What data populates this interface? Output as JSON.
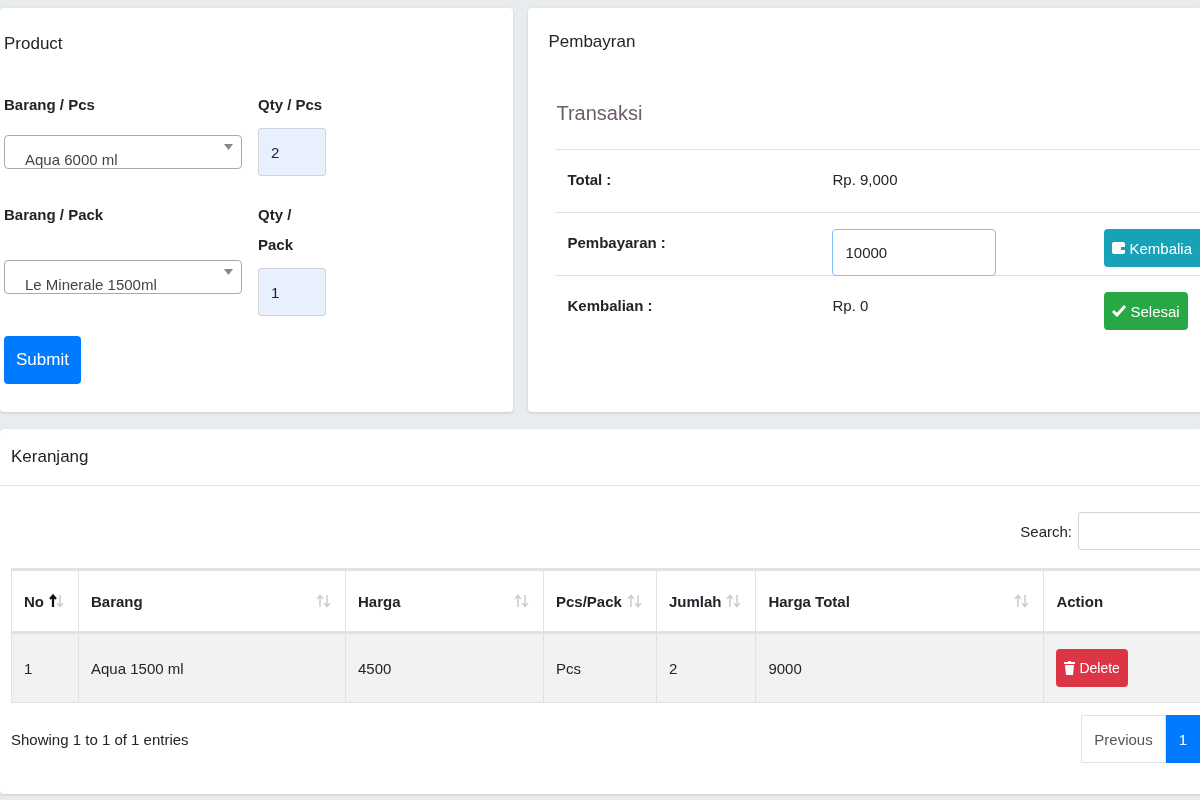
{
  "product": {
    "title": "Product",
    "rows": [
      {
        "item_label": "Barang / Pcs",
        "item_value": "Aqua 6000 ml",
        "qty_label": "Qty / Pcs",
        "qty_value": "2"
      },
      {
        "item_label": "Barang / Pack",
        "item_value": "Le Minerale 1500ml",
        "qty_label": "Qty / Pack",
        "qty_value": "1"
      }
    ],
    "submit": "Submit"
  },
  "payment": {
    "title": "Pembayran",
    "subtitle": "Transaksi",
    "rows": [
      {
        "kind": "text",
        "label": "Total :",
        "value": "Rp. 9,000"
      },
      {
        "kind": "input",
        "label": "Pembayaran :",
        "value": "10000",
        "action": {
          "kind": "info",
          "label": "Kembalia"
        }
      },
      {
        "kind": "text",
        "label": "Kembalian :",
        "value": "Rp. 0",
        "action": {
          "kind": "success",
          "label": "Selesai"
        }
      }
    ]
  },
  "cart": {
    "title": "Keranjang",
    "search_label": "Search:",
    "columns": [
      {
        "label": "No",
        "sortable": true,
        "sorted": true
      },
      {
        "label": "Barang",
        "sortable": true,
        "sorted": false
      },
      {
        "label": "Harga",
        "sortable": true,
        "sorted": false
      },
      {
        "label": "Pcs/Pack",
        "sortable": true,
        "sorted": false
      },
      {
        "label": "Jumlah",
        "sortable": true,
        "sorted": false
      },
      {
        "label": "Harga Total",
        "sortable": true,
        "sorted": false
      },
      {
        "label": "Action",
        "sortable": false
      }
    ],
    "rows": [
      {
        "cells": [
          "1",
          "Aqua 1500 ml",
          "4500",
          "Pcs",
          "2",
          "9000"
        ],
        "action": "Delete"
      }
    ],
    "info": "Showing 1 to 1 of 1 entries",
    "pagination": [
      {
        "label": "Previous",
        "selected": false
      },
      {
        "label": "1",
        "selected": true
      }
    ]
  }
}
